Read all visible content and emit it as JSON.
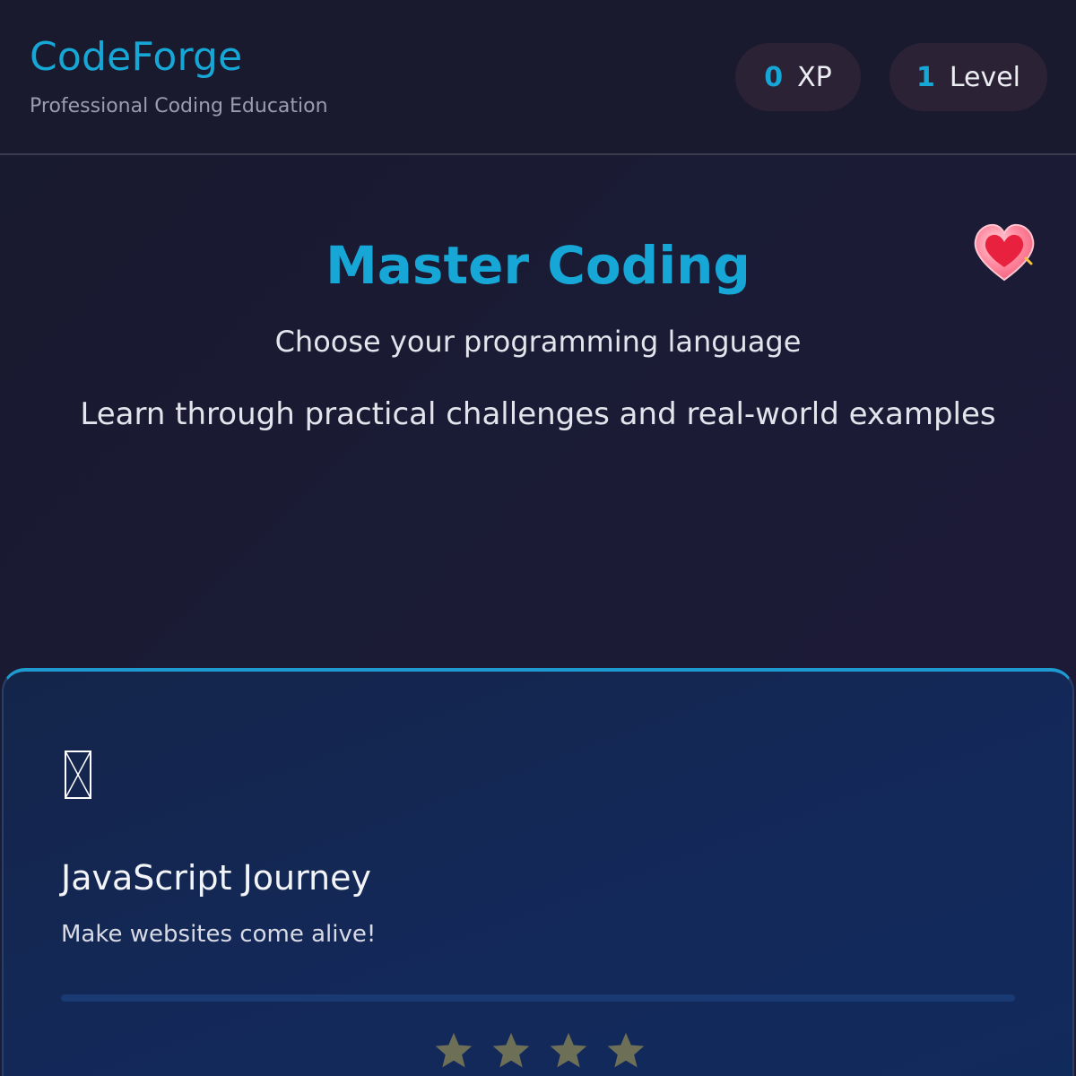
{
  "header": {
    "brand_title": "CodeForge",
    "brand_subtitle": "Professional Coding Education",
    "xp": {
      "value": "0",
      "label": "XP"
    },
    "level": {
      "value": "1",
      "label": "Level"
    }
  },
  "hero": {
    "title": "Master Coding",
    "subtitle": "Choose your programming language",
    "description": "Learn through practical challenges and real-world examples",
    "favorite_icon": "heart-icon"
  },
  "course_card": {
    "icon": "broken-glyph-icon",
    "title": "JavaScript Journey",
    "description": "Make websites come alive!",
    "rating_stars": 4
  },
  "colors": {
    "accent": "#17a7d6",
    "pill_bg": "#2c2235",
    "card_bg": "#13295a",
    "star": "#6e6f57"
  }
}
